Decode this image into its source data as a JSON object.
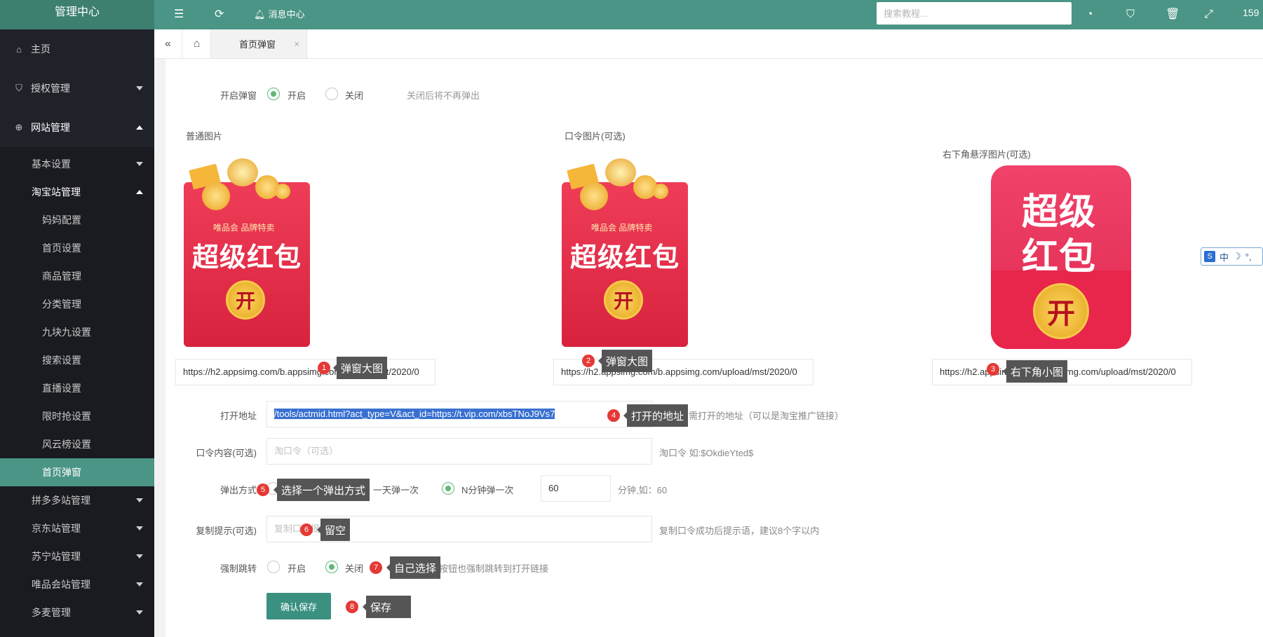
{
  "topbar": {
    "brand": "管理中心",
    "messages_label": "消息中心",
    "search_placeholder": "搜索教程...",
    "right_number": "159"
  },
  "sidebar": {
    "home": "主页",
    "auth": "授权管理",
    "site": "网站管理",
    "basic_settings": "基本设置",
    "taobao": "淘宝站管理",
    "taobao_items": [
      "妈妈配置",
      "首页设置",
      "商品管理",
      "分类管理",
      "九块九设置",
      "搜索设置",
      "直播设置",
      "限时抢设置",
      "风云榜设置",
      "首页弹窗"
    ],
    "pdd": "拼多多站管理",
    "jd": "京东站管理",
    "suning": "苏宁站管理",
    "vip": "唯品会站管理",
    "duomai": "多麦管理"
  },
  "tabs": {
    "active": "首页弹窗",
    "close": "×"
  },
  "form": {
    "popup_label": "开启弹窗",
    "popup_on": "开启",
    "popup_off": "关闭",
    "popup_hint": "关闭后将不再弹出",
    "img_normal_label": "普通图片",
    "img_password_label": "口令图片(可选)",
    "img_float_label": "右下角悬浮图片(可选)",
    "img_normal_url": "https://h2.appsimg.com/b.appsimg.com/upload/mst/2020/0",
    "img_password_url": "https://h2.appsimg.com/b.appsimg.com/upload/mst/2020/0",
    "img_float_url": "https://h2.appsimg.com/b.appsimg.com/upload/mst/2020/0",
    "open_url_label": "打开地址",
    "open_url_value": "/tools/actmid.html?act_type=V&act_id=https://t.vip.com/xbsTNoJ9Vs7",
    "open_url_hint": "需打开的地址（可以是淘宝推广链接）",
    "password_label": "口令内容(可选)",
    "password_placeholder": "淘口令（可选）",
    "password_hint": "淘口令 如:$OkdieYted$",
    "mode_label": "弹出方式",
    "mode_daily": "一天弹一次",
    "mode_n_minutes": "N分钟弹一次",
    "minutes_value": "60",
    "minutes_hint": "分钟,如：60",
    "copy_label": "复制提示(可选)",
    "copy_placeholder": "复制口令提示",
    "copy_hint": "复制口令成功后提示语，建议8个字以内",
    "force_label": "强制跳转",
    "force_on": "开启",
    "force_off": "关闭",
    "force_hint": "关闭按钮也强制跳转到打开链接",
    "save_button": "确认保存"
  },
  "envelope": {
    "brand": "唯品会 品牌特卖",
    "title": "超级红包",
    "open": "开",
    "float_line1": "超级",
    "float_line2": "红包"
  },
  "annotations": [
    {
      "n": "1",
      "text": "弹窗大图"
    },
    {
      "n": "2",
      "text": "弹窗大图"
    },
    {
      "n": "3",
      "text": "右下角小图"
    },
    {
      "n": "4",
      "text": "打开的地址"
    },
    {
      "n": "5",
      "text": "选择一个弹出方式"
    },
    {
      "n": "6",
      "text": "留空"
    },
    {
      "n": "7",
      "text": "自己选择"
    },
    {
      "n": "8",
      "text": "保存"
    }
  ],
  "ime": {
    "s": "S",
    "zh": "中",
    "moon": "☽",
    "dot": "°,"
  }
}
